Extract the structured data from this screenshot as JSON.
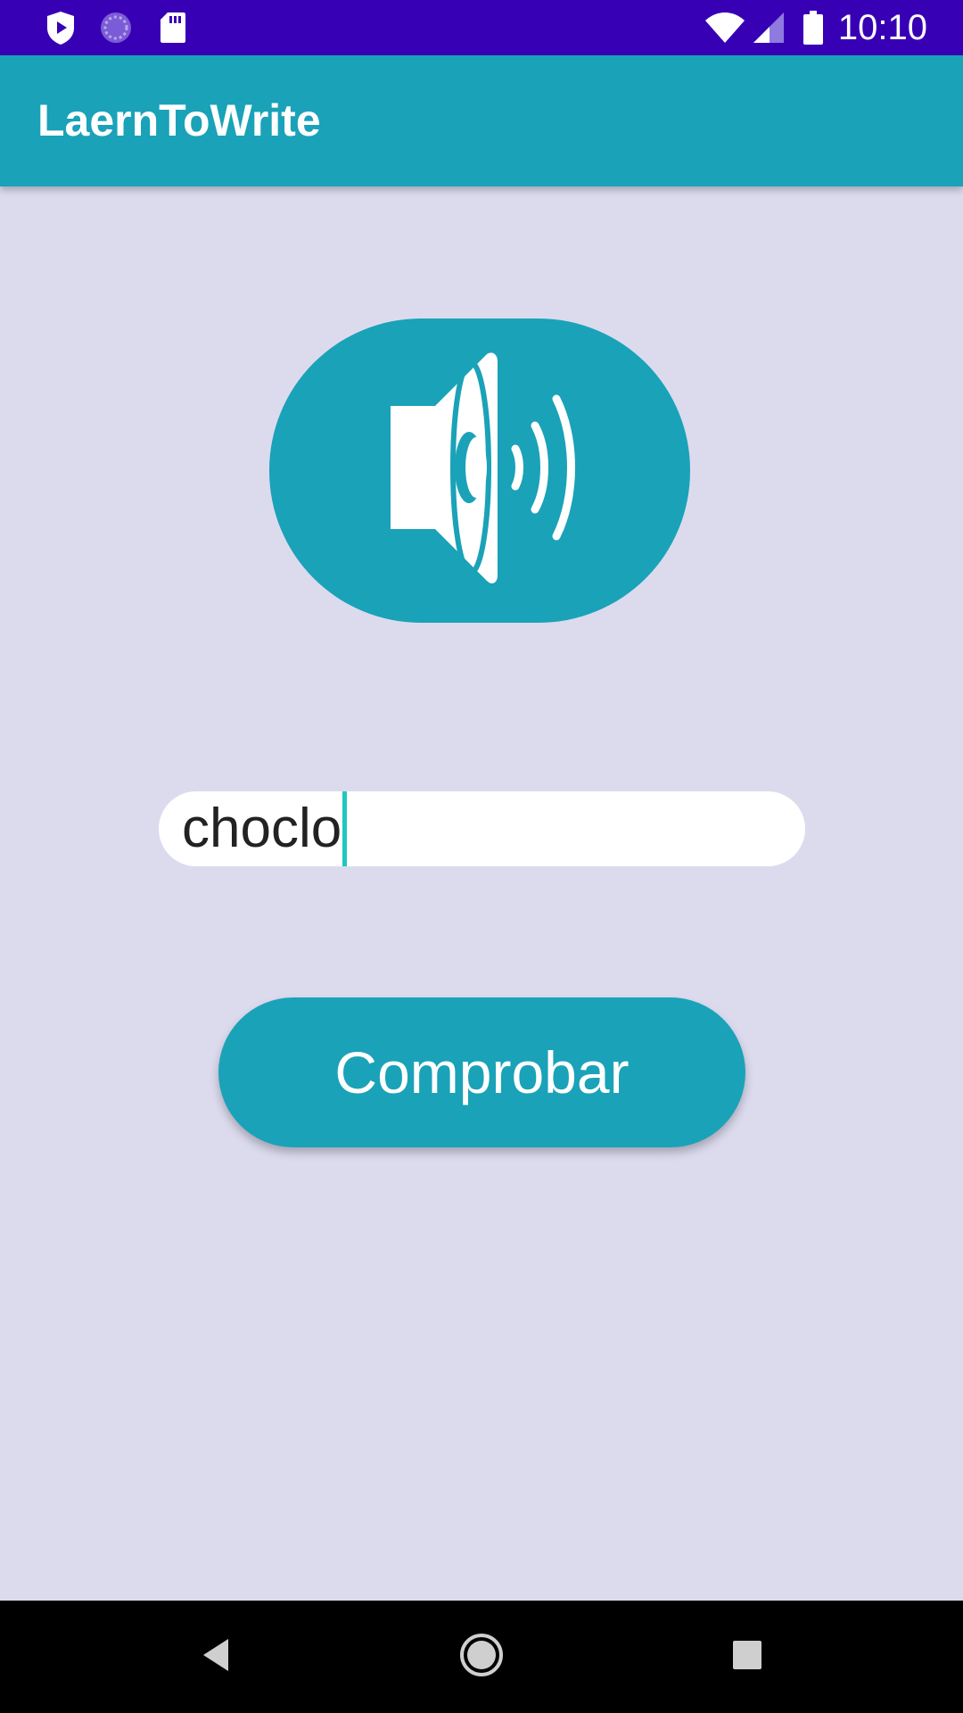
{
  "status_bar": {
    "time": "10:10",
    "icons": [
      "play-protect-icon",
      "sync-icon",
      "sd-card-icon",
      "wifi-icon",
      "signal-icon",
      "battery-icon"
    ]
  },
  "app_bar": {
    "title": "LaernToWrite"
  },
  "speak_button": {
    "icon": "speaker-icon"
  },
  "answer_field": {
    "value": "choclo"
  },
  "check_button": {
    "label": "Comprobar"
  },
  "nav_bar": {
    "icons": [
      "back-icon",
      "home-icon",
      "recents-icon"
    ]
  },
  "colors": {
    "status_bar": "#3800b5",
    "accent": "#1aa2b8",
    "background": "#dcdbee",
    "cursor": "#1ec8c0"
  }
}
